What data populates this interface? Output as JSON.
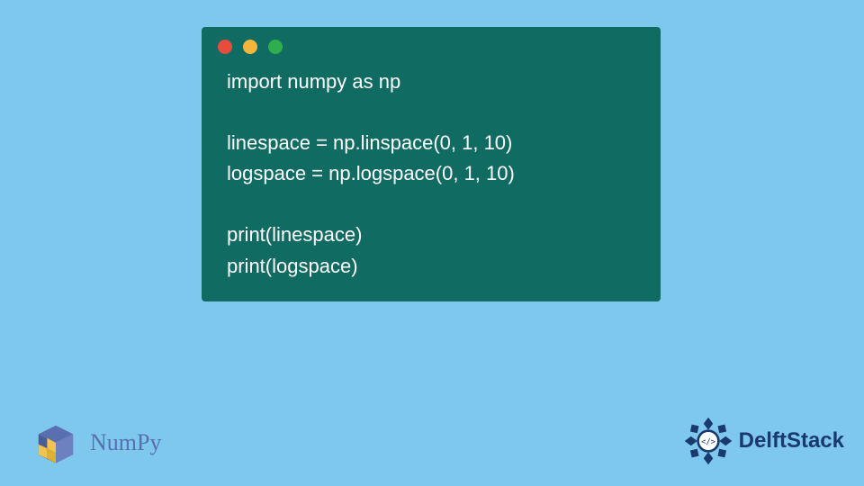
{
  "code_window": {
    "dots": [
      "red",
      "yellow",
      "green"
    ],
    "lines": [
      "import numpy as np",
      "",
      "linespace = np.linspace(0, 1, 10)",
      "logspace = np.logspace(0, 1, 10)",
      "",
      "print(linespace)",
      "print(logspace)"
    ]
  },
  "numpy": {
    "label": "NumPy"
  },
  "delft": {
    "label": "DelftStack"
  }
}
